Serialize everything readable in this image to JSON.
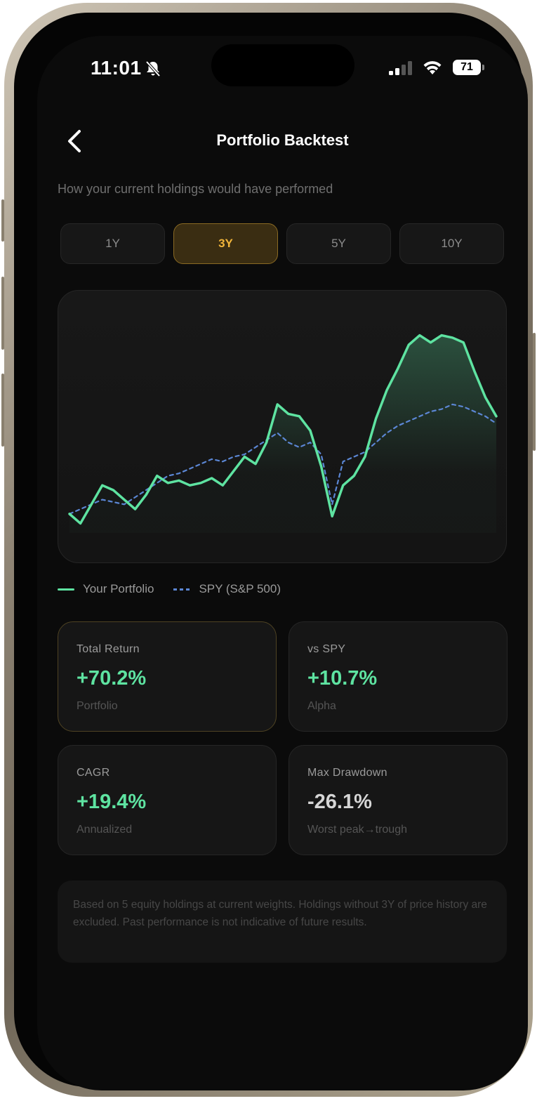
{
  "status_bar": {
    "time": "11:01",
    "battery": "71"
  },
  "header": {
    "title": "Portfolio Backtest",
    "subtitle": "How your current holdings would have performed"
  },
  "periods": [
    {
      "label": "1Y",
      "active": false
    },
    {
      "label": "3Y",
      "active": true
    },
    {
      "label": "5Y",
      "active": false
    },
    {
      "label": "10Y",
      "active": false
    }
  ],
  "legend": {
    "portfolio": "Your Portfolio",
    "benchmark": "SPY (S&P 500)"
  },
  "stats": [
    {
      "label": "Total Return",
      "value": "+70.2%",
      "sub": "Portfolio"
    },
    {
      "label": "vs SPY",
      "value": "+10.7%",
      "sub": "Alpha"
    },
    {
      "label": "CAGR",
      "value": "+19.4%",
      "sub": "Annualized"
    },
    {
      "label": "Max Drawdown",
      "value": "-26.1%",
      "sub": "Worst peak→trough"
    }
  ],
  "disclaimer": "Based on 5 equity holdings at current weights. Holdings without 3Y of price history are excluded. Past performance is not indicative of future results.",
  "colors": {
    "portfolio": "#5ee3a1",
    "benchmark": "#5b86d4",
    "accent": "#f1b53a"
  },
  "chart_data": {
    "type": "line",
    "x": [
      0,
      4,
      8,
      12,
      16,
      20,
      24,
      28,
      32,
      36,
      40,
      44,
      48,
      52,
      56,
      60,
      64,
      68,
      72,
      76,
      80,
      84,
      88,
      92,
      96,
      100,
      104,
      108,
      112,
      116,
      120,
      124,
      128,
      132,
      136,
      140,
      144,
      148,
      152,
      156
    ],
    "series": [
      {
        "name": "Your Portfolio",
        "values": [
          100,
          96,
          104,
          112,
          110,
          106,
          102,
          108,
          116,
          113,
          114,
          112,
          113,
          115,
          112,
          118,
          124,
          121,
          130,
          146,
          142,
          141,
          135,
          120,
          99,
          112,
          116,
          124,
          140,
          152,
          161,
          171,
          175,
          172,
          175,
          174,
          172,
          160,
          149,
          141
        ]
      },
      {
        "name": "SPY (S&P 500)",
        "values": [
          100,
          102,
          104,
          106,
          105,
          104,
          107,
          110,
          113,
          116,
          117,
          119,
          121,
          123,
          122,
          124,
          125,
          128,
          131,
          134,
          130,
          128,
          130,
          125,
          104,
          122,
          124,
          126,
          130,
          134,
          137,
          139,
          141,
          143,
          144,
          146,
          145,
          143,
          141,
          138
        ]
      }
    ]
  }
}
